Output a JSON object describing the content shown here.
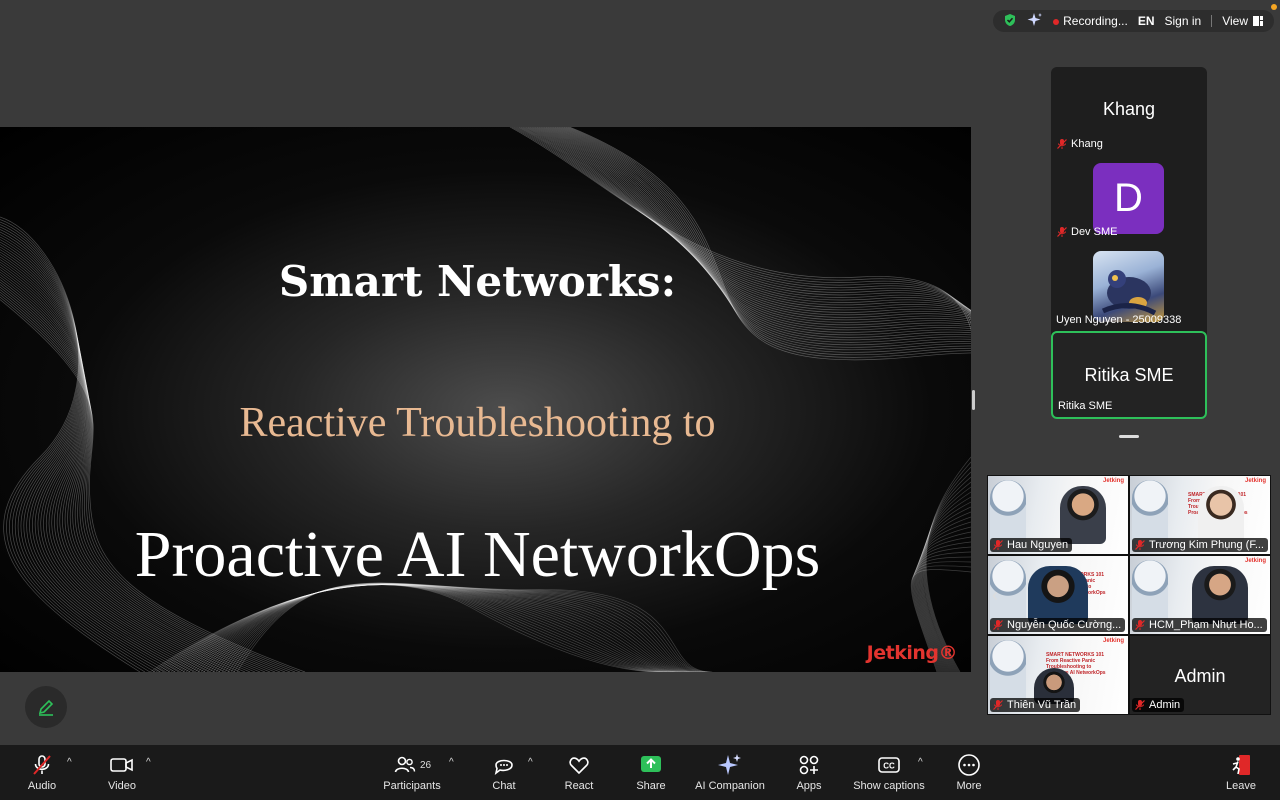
{
  "status_bar": {
    "recording_label": "Recording...",
    "language": "EN",
    "sign_in": "Sign in",
    "view": "View"
  },
  "slide": {
    "title": "Smart Networks:",
    "subtitle": "Reactive Troubleshooting to",
    "headline": "Proactive AI NetworkOps",
    "brand": "Jetking®"
  },
  "speaker_panel": [
    {
      "display": "Khang",
      "label": "Khang"
    },
    {
      "avatar_letter": "D",
      "label": "Dev SME"
    },
    {
      "label": "Uyen Nguyen - 25009338"
    },
    {
      "display": "Ritika SME",
      "label": "Ritika SME"
    }
  ],
  "video_grid": [
    {
      "name": "Hau Nguyen"
    },
    {
      "name": "Trương Kim Phụng (F..."
    },
    {
      "name": "Nguyễn Quốc Cường..."
    },
    {
      "name": "HCM_Phạm Nhựt Ho..."
    },
    {
      "name": "Thiên Vũ Trần"
    },
    {
      "name": "Admin",
      "display": "Admin"
    }
  ],
  "tile_slide_text": "SMART NETWORKS 101\nFrom Reactive Panic\nTroubleshooting to\nProactive AI NetworkOps",
  "tile_brand": "Jetking",
  "toolbar": {
    "audio": "Audio",
    "video": "Video",
    "participants": "Participants",
    "participants_count": "26",
    "chat": "Chat",
    "react": "React",
    "share": "Share",
    "ai_companion": "AI Companion",
    "apps": "Apps",
    "captions": "Show captions",
    "more": "More",
    "leave": "Leave"
  },
  "colors": {
    "background": "#3a3a3a",
    "toolbar": "#1a1a1a",
    "share_green": "#2ec05a",
    "leave_red": "#e02828",
    "slide_subtitle": "#e8b992",
    "avatar_purple": "#7b2fbf"
  }
}
